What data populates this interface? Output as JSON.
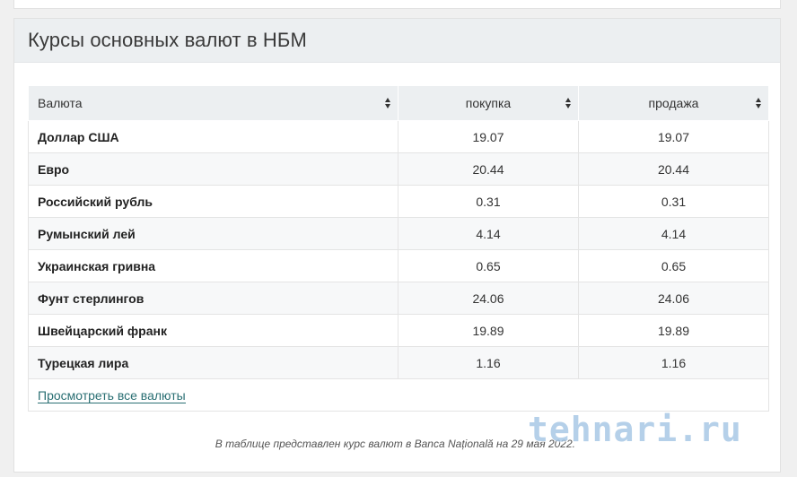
{
  "widget": {
    "title": "Курсы основных валют в НБМ"
  },
  "table": {
    "headers": [
      "Валюта",
      "покупка",
      "продажа"
    ],
    "rows": [
      {
        "name": "Доллар США",
        "buy": "19.07",
        "sell": "19.07"
      },
      {
        "name": "Евро",
        "buy": "20.44",
        "sell": "20.44"
      },
      {
        "name": "Российский рубль",
        "buy": "0.31",
        "sell": "0.31"
      },
      {
        "name": "Румынский лей",
        "buy": "4.14",
        "sell": "4.14"
      },
      {
        "name": "Украинская гривна",
        "buy": "0.65",
        "sell": "0.65"
      },
      {
        "name": "Фунт стерлингов",
        "buy": "24.06",
        "sell": "24.06"
      },
      {
        "name": "Швейцарский франк",
        "buy": "19.89",
        "sell": "19.89"
      },
      {
        "name": "Турецкая лира",
        "buy": "1.16",
        "sell": "1.16"
      }
    ],
    "view_all_link": "Просмотреть все валюты"
  },
  "note": "В таблице представлен курс валют в Banca Națională на 29 мая 2022.",
  "watermark": "tehnari.ru",
  "colors": {
    "header_bg": "#eceff1",
    "link": "#2a6f73",
    "watermark": "#78aad7"
  }
}
